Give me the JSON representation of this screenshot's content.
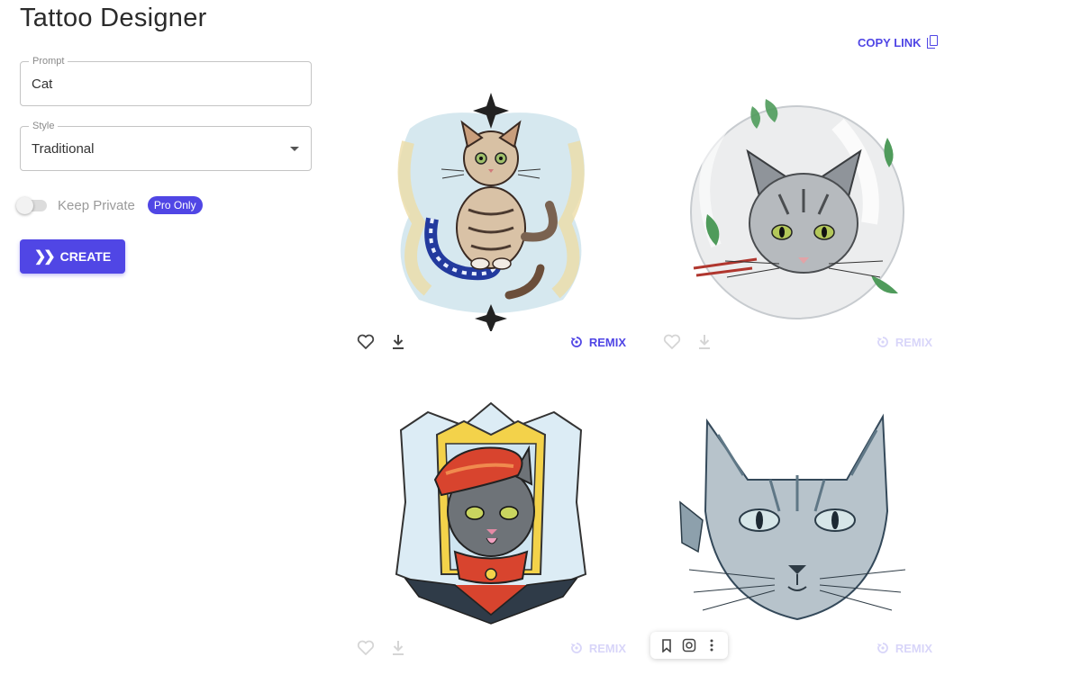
{
  "app": {
    "title": "Tattoo Designer"
  },
  "form": {
    "prompt": {
      "legend": "Prompt",
      "value": "Cat"
    },
    "style": {
      "legend": "Style",
      "value": "Traditional"
    },
    "keep_private": {
      "label": "Keep Private",
      "badge": "Pro Only",
      "on": false
    },
    "create_label": "CREATE"
  },
  "header": {
    "copy_link_label": "COPY LINK"
  },
  "gallery": {
    "cards": [
      {
        "remix_label": "REMIX"
      },
      {
        "remix_label": "REMIX"
      },
      {
        "remix_label": "REMIX"
      },
      {
        "remix_label": "REMIX"
      }
    ]
  },
  "colors": {
    "accent": "#5046e5",
    "border": "#c4c4c4"
  },
  "icons": [
    "chevrons-right-icon",
    "copy-icon",
    "heart-icon",
    "download-icon",
    "remix-icon",
    "bookmark-icon",
    "lens-icon",
    "more-vert-icon",
    "dropdown-caret-icon"
  ]
}
